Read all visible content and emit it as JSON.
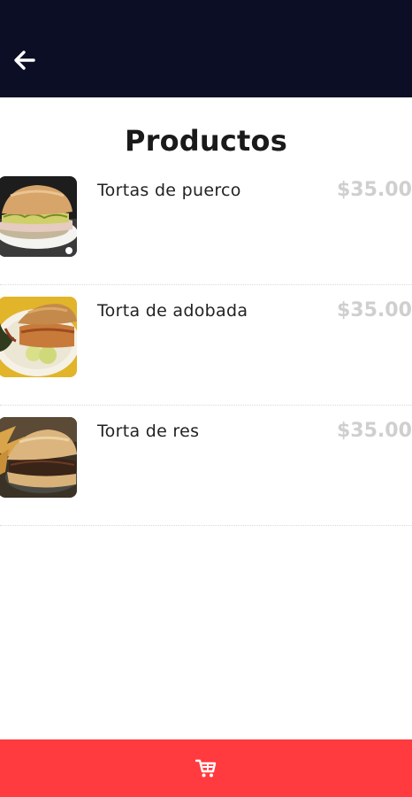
{
  "header": {
    "back_icon": "arrow-left-icon",
    "bg_color": "#0b0e24"
  },
  "page": {
    "title": "Productos"
  },
  "products": [
    {
      "name": "Tortas de puerco",
      "price": "$35.00",
      "image": "torta-de-puerco-photo"
    },
    {
      "name": "Torta de adobada",
      "price": "$35.00",
      "image": "torta-de-adobada-photo"
    },
    {
      "name": "Torta de res",
      "price": "$35.00",
      "image": "torta-de-res-photo"
    }
  ],
  "footer": {
    "cart_icon": "shopping-cart-icon",
    "bg_color": "#ff3b3f"
  },
  "colors": {
    "price": "#cfcfcf",
    "text": "#222222"
  }
}
